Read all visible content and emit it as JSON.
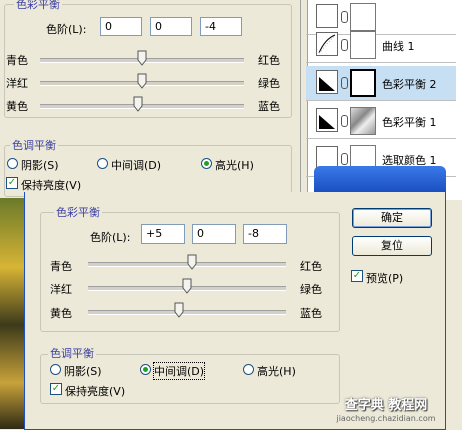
{
  "bg_panel": {
    "group_title_top": "色彩平衡",
    "levels_label": "色阶(L):",
    "levels": [
      "0",
      "0",
      "-4"
    ],
    "sliders": [
      {
        "left": "青色",
        "right": "红色",
        "value": 0
      },
      {
        "left": "洋红",
        "right": "绿色",
        "value": 0
      },
      {
        "left": "黄色",
        "right": "蓝色",
        "value": -4
      }
    ],
    "tone_title": "色调平衡",
    "tones": [
      "阴影(S)",
      "中间调(D)",
      "高光(H)"
    ],
    "tone_selected": 2,
    "preserve": "保持亮度(V)"
  },
  "layers": [
    {
      "name": "",
      "type": "adjustment"
    },
    {
      "name": "曲线 1",
      "type": "curves"
    },
    {
      "name": "色彩平衡 2",
      "type": "color-balance",
      "selected": true
    },
    {
      "name": "色彩平衡 1",
      "type": "color-balance"
    },
    {
      "name": "选取颜色 1",
      "type": "selective-color"
    }
  ],
  "dialog": {
    "group_title": "色彩平衡",
    "levels_label": "色阶(L):",
    "levels": [
      "+5",
      "0",
      "-8"
    ],
    "sliders": [
      {
        "left": "青色",
        "right": "红色",
        "value": 5
      },
      {
        "left": "洋红",
        "right": "绿色",
        "value": 0
      },
      {
        "left": "黄色",
        "right": "蓝色",
        "value": -8
      }
    ],
    "tone_title": "色调平衡",
    "tones": [
      "阴影(S)",
      "中间调(D)",
      "高光(H)"
    ],
    "tone_selected": 1,
    "preserve": "保持亮度(V)",
    "ok": "确定",
    "reset": "复位",
    "preview": "预览(P)"
  },
  "watermarks": {
    "site_top": "查字典 教程网",
    "site_bottom": "jiaocheng.chazidian.com"
  },
  "colors": {
    "accent": "#3b3fa3",
    "title_bar": "#2456c4",
    "selected_layer": "#c6dff3"
  }
}
